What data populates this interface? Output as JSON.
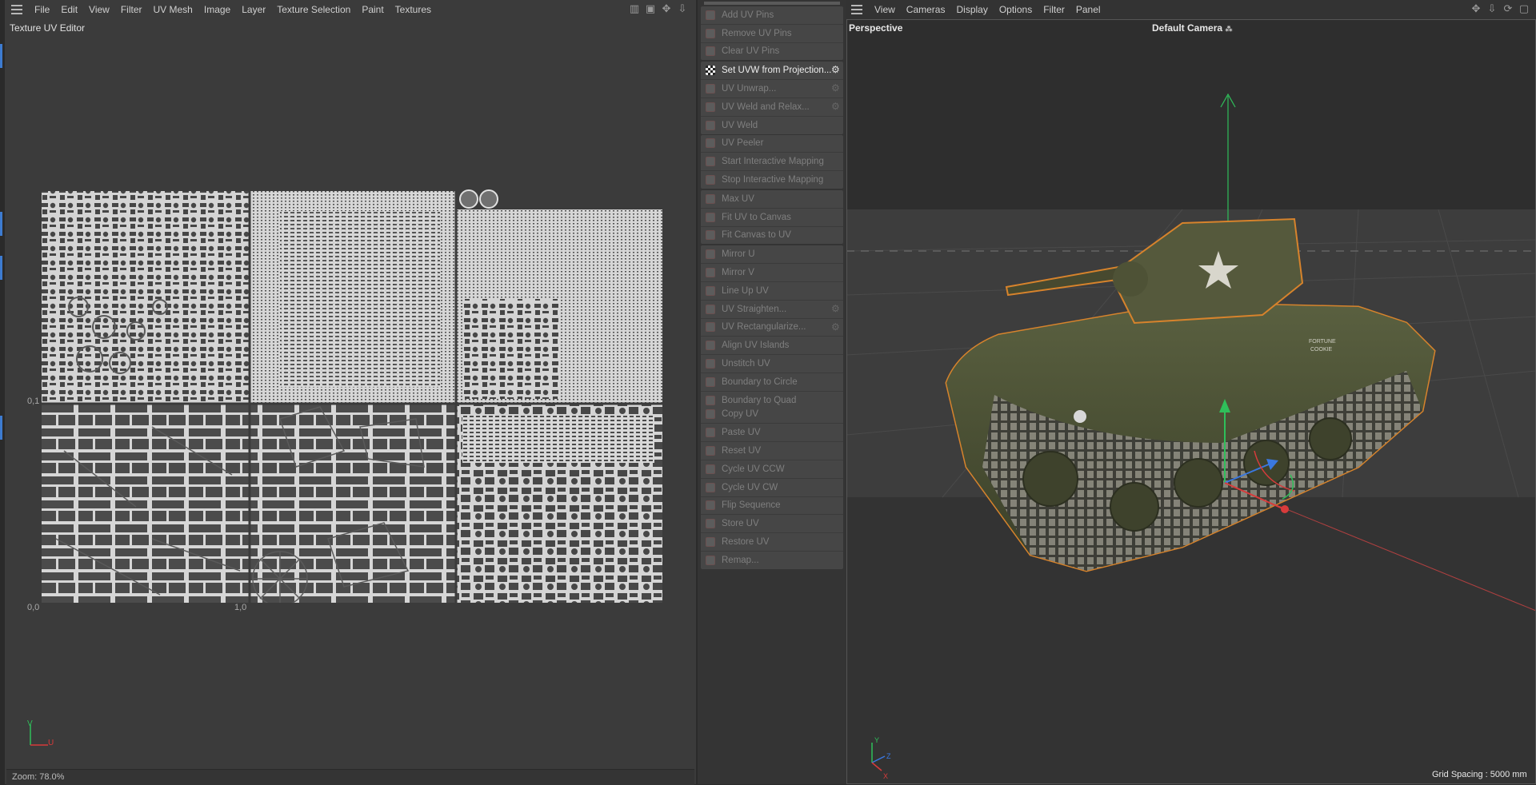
{
  "uv_editor": {
    "menu": [
      "File",
      "Edit",
      "View",
      "Filter",
      "UV Mesh",
      "Image",
      "Layer",
      "Texture Selection",
      "Paint",
      "Textures"
    ],
    "title": "Texture UV Editor",
    "coords": {
      "mid_left": "0,1",
      "bottom_left": "0,0",
      "bottom_mid": "1,0"
    },
    "axes": {
      "vertical": "V",
      "horizontal": "U"
    },
    "status": "Zoom: 78.0%",
    "top_icons": [
      "chart-icon",
      "lock-icon",
      "move-icon",
      "anchor-icon"
    ]
  },
  "palette": {
    "groups": [
      {
        "items": [
          {
            "label": "Add UV Pins",
            "icon": "add-pin-icon",
            "enabled": false,
            "gear": false
          },
          {
            "label": "Remove UV Pins",
            "icon": "remove-pin-icon",
            "enabled": false,
            "gear": false
          },
          {
            "label": "Clear UV Pins",
            "icon": "clear-pin-icon",
            "enabled": false,
            "gear": false
          }
        ]
      },
      {
        "items": [
          {
            "label": "Set UVW from Projection...",
            "icon": "checker-icon",
            "enabled": true,
            "gear": true
          },
          {
            "label": "UV Unwrap...",
            "icon": "unwrap-icon",
            "enabled": false,
            "gear": true
          },
          {
            "label": "UV Weld and Relax...",
            "icon": "weld-relax-icon",
            "enabled": false,
            "gear": true
          },
          {
            "label": "UV Weld",
            "icon": "weld-icon",
            "enabled": false,
            "gear": false
          }
        ]
      },
      {
        "items": [
          {
            "label": "UV Peeler",
            "icon": "peeler-icon",
            "enabled": false,
            "gear": false
          },
          {
            "label": "Start Interactive Mapping",
            "icon": "start-mapping-icon",
            "enabled": false,
            "gear": false
          },
          {
            "label": "Stop Interactive Mapping",
            "icon": "stop-mapping-icon",
            "enabled": false,
            "gear": false
          }
        ]
      },
      {
        "items": [
          {
            "label": "Max UV",
            "icon": "max-uv-icon",
            "enabled": false,
            "gear": false
          },
          {
            "label": "Fit UV to Canvas",
            "icon": "fit-uv-icon",
            "enabled": false,
            "gear": false
          },
          {
            "label": "Fit Canvas to UV",
            "icon": "fit-canvas-icon",
            "enabled": false,
            "gear": false
          }
        ]
      },
      {
        "items": [
          {
            "label": "Mirror U",
            "icon": "mirror-u-icon",
            "enabled": false,
            "gear": false
          },
          {
            "label": "Mirror V",
            "icon": "mirror-v-icon",
            "enabled": false,
            "gear": false
          },
          {
            "label": "Line Up UV",
            "icon": "line-up-icon",
            "enabled": false,
            "gear": false
          },
          {
            "label": "UV Straighten...",
            "icon": "straighten-icon",
            "enabled": false,
            "gear": true
          },
          {
            "label": "UV Rectangularize...",
            "icon": "rectangularize-icon",
            "enabled": false,
            "gear": true
          },
          {
            "label": "Align UV Islands",
            "icon": "align-islands-icon",
            "enabled": false,
            "gear": false
          },
          {
            "label": "Unstitch UV",
            "icon": "unstitch-icon",
            "enabled": false,
            "gear": false
          },
          {
            "label": "Boundary to Circle",
            "icon": "boundary-circle-icon",
            "enabled": false,
            "gear": false
          },
          {
            "label": "Boundary to Quad",
            "icon": "boundary-quad-icon",
            "enabled": false,
            "gear": false
          }
        ]
      },
      {
        "items": [
          {
            "label": "Copy UV",
            "icon": "copy-uv-icon",
            "enabled": false,
            "gear": false
          },
          {
            "label": "Paste UV",
            "icon": "paste-uv-icon",
            "enabled": false,
            "gear": false
          },
          {
            "label": "Reset UV",
            "icon": "reset-uv-icon",
            "enabled": false,
            "gear": false
          },
          {
            "label": "Cycle UV CCW",
            "icon": "cycle-ccw-icon",
            "enabled": false,
            "gear": false
          },
          {
            "label": "Cycle UV CW",
            "icon": "cycle-cw-icon",
            "enabled": false,
            "gear": false
          },
          {
            "label": "Flip Sequence",
            "icon": "flip-sequence-icon",
            "enabled": false,
            "gear": false
          },
          {
            "label": "Store UV",
            "icon": "store-uv-icon",
            "enabled": false,
            "gear": false
          },
          {
            "label": "Restore UV",
            "icon": "restore-uv-icon",
            "enabled": false,
            "gear": false
          },
          {
            "label": "Remap...",
            "icon": "remap-icon",
            "enabled": false,
            "gear": false
          }
        ]
      }
    ]
  },
  "viewport": {
    "menu": [
      "View",
      "Cameras",
      "Display",
      "Options",
      "Filter",
      "Panel"
    ],
    "label": "Perspective",
    "camera": "Default Camera",
    "grid_spacing": "Grid Spacing : 5000 mm",
    "top_icons": [
      "move-icon",
      "anchor-icon",
      "rotate-icon",
      "maximize-icon"
    ],
    "decal_text": [
      "FORTUNE",
      "COOKIE"
    ],
    "axes": {
      "y": "Y",
      "z": "Z",
      "x": "X"
    }
  },
  "colors": {
    "accent_blue": "#3d7bd0",
    "selection_orange": "#d7832c",
    "tank_green": "#4b5232",
    "uv_island_fill": "#d6d6d6",
    "axis_green": "#2fbf5a",
    "axis_red": "#d83b3b",
    "axis_blue": "#3a78e0"
  }
}
